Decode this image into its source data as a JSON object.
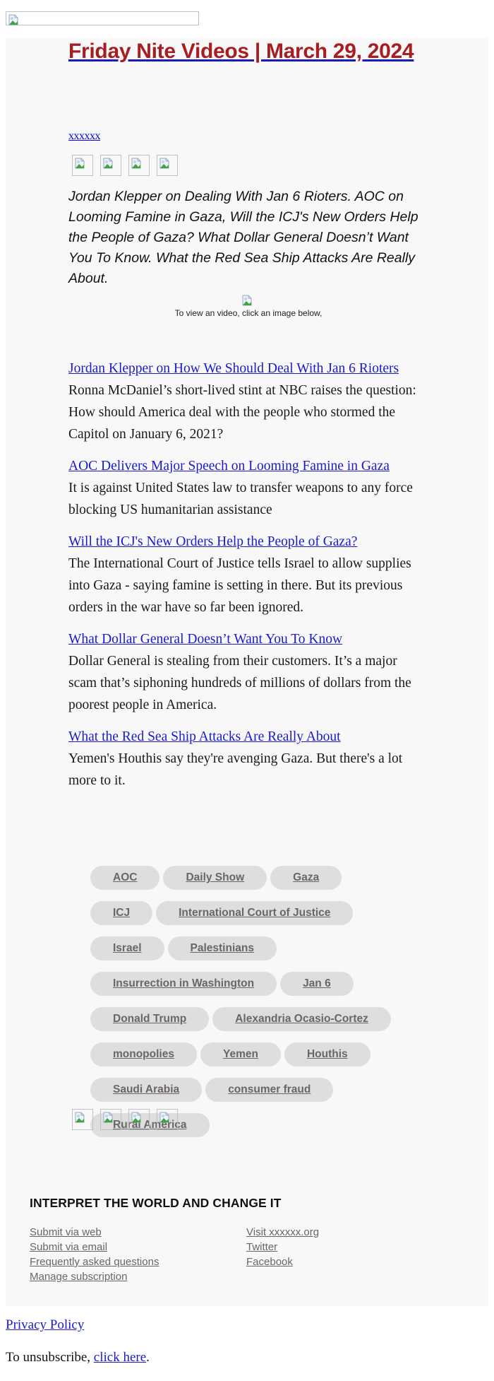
{
  "header": {
    "logo_icon": "broken-image-icon"
  },
  "newsletter": {
    "title": "Friday Nite Videos | March 29, 2024",
    "brand_link": "xxxxxx",
    "intro": "Jordan Klepper on Dealing With Jan 6 Rioters. AOC on Looming Famine in Gaza, Will the ICJ's New Orders Help the People of Gaza? What Dollar General Doesn’t Want You To Know. What the Red Sea Ship Attacks Are Really About.",
    "video_hint": "To view an video, click an image below,"
  },
  "social_icons_top": [
    "broken-image-icon",
    "broken-image-icon",
    "broken-image-icon",
    "broken-image-icon"
  ],
  "stories": [
    {
      "title": "Jordan Klepper on How We Should Deal With Jan 6 Rioters",
      "description": "Ronna McDaniel’s short-lived stint at NBC raises the question: How should America deal with the people who stormed the Capitol on January 6, 2021?"
    },
    {
      "title": "AOC Delivers Major Speech on Looming Famine in Gaza",
      "description": "It is against United States law to transfer weapons to any force blocking US humanitarian assistance"
    },
    {
      "title": "Will the ICJ's New Orders Help the People of Gaza?",
      "description": "The International Court of Justice tells Israel to allow supplies into Gaza - saying famine is setting in there. But its previous orders in the war have so far been ignored."
    },
    {
      "title": "What Dollar General Doesn’t Want You To Know",
      "description": "Dollar General is stealing from their customers. It’s a major scam that’s siphoning hundreds of millions of dollars from the poorest people in America."
    },
    {
      "title": "What the Red Sea Ship Attacks Are Really About",
      "description": "Yemen's Houthis say they're avenging Gaza. But there's a lot more to it."
    }
  ],
  "tags": [
    "AOC",
    "Daily Show",
    "Gaza",
    "ICJ",
    "International Court of Justice",
    "Israel",
    "Palestinians",
    "Insurrection in Washington",
    "Jan 6",
    "Donald Trump",
    "Alexandria Ocasio-Cortez",
    "monopolies",
    "Yemen",
    "Houthis",
    "Saudi Arabia",
    "consumer fraud",
    "Rural America"
  ],
  "social_icons_bottom": [
    "broken-image-icon",
    "broken-image-icon",
    "broken-image-icon",
    "broken-image-icon"
  ],
  "footer": {
    "heading": "INTERPRET THE WORLD AND CHANGE IT",
    "left_links": [
      "Submit via web",
      "Submit via email",
      "Frequently asked questions",
      "Manage subscription"
    ],
    "right_links": [
      "Visit xxxxxx.org",
      "Twitter",
      "Facebook"
    ]
  },
  "legal": {
    "privacy_policy": "Privacy Policy",
    "unsubscribe_prefix": "To unsubscribe, ",
    "unsubscribe_link": "click here",
    "unsubscribe_suffix": "."
  },
  "colors": {
    "title": "#a61e22",
    "link": "#1a1acc",
    "tag_bg": "#dedede",
    "tag_text": "#6b6565",
    "panel_bg": "#f8f8f8"
  }
}
